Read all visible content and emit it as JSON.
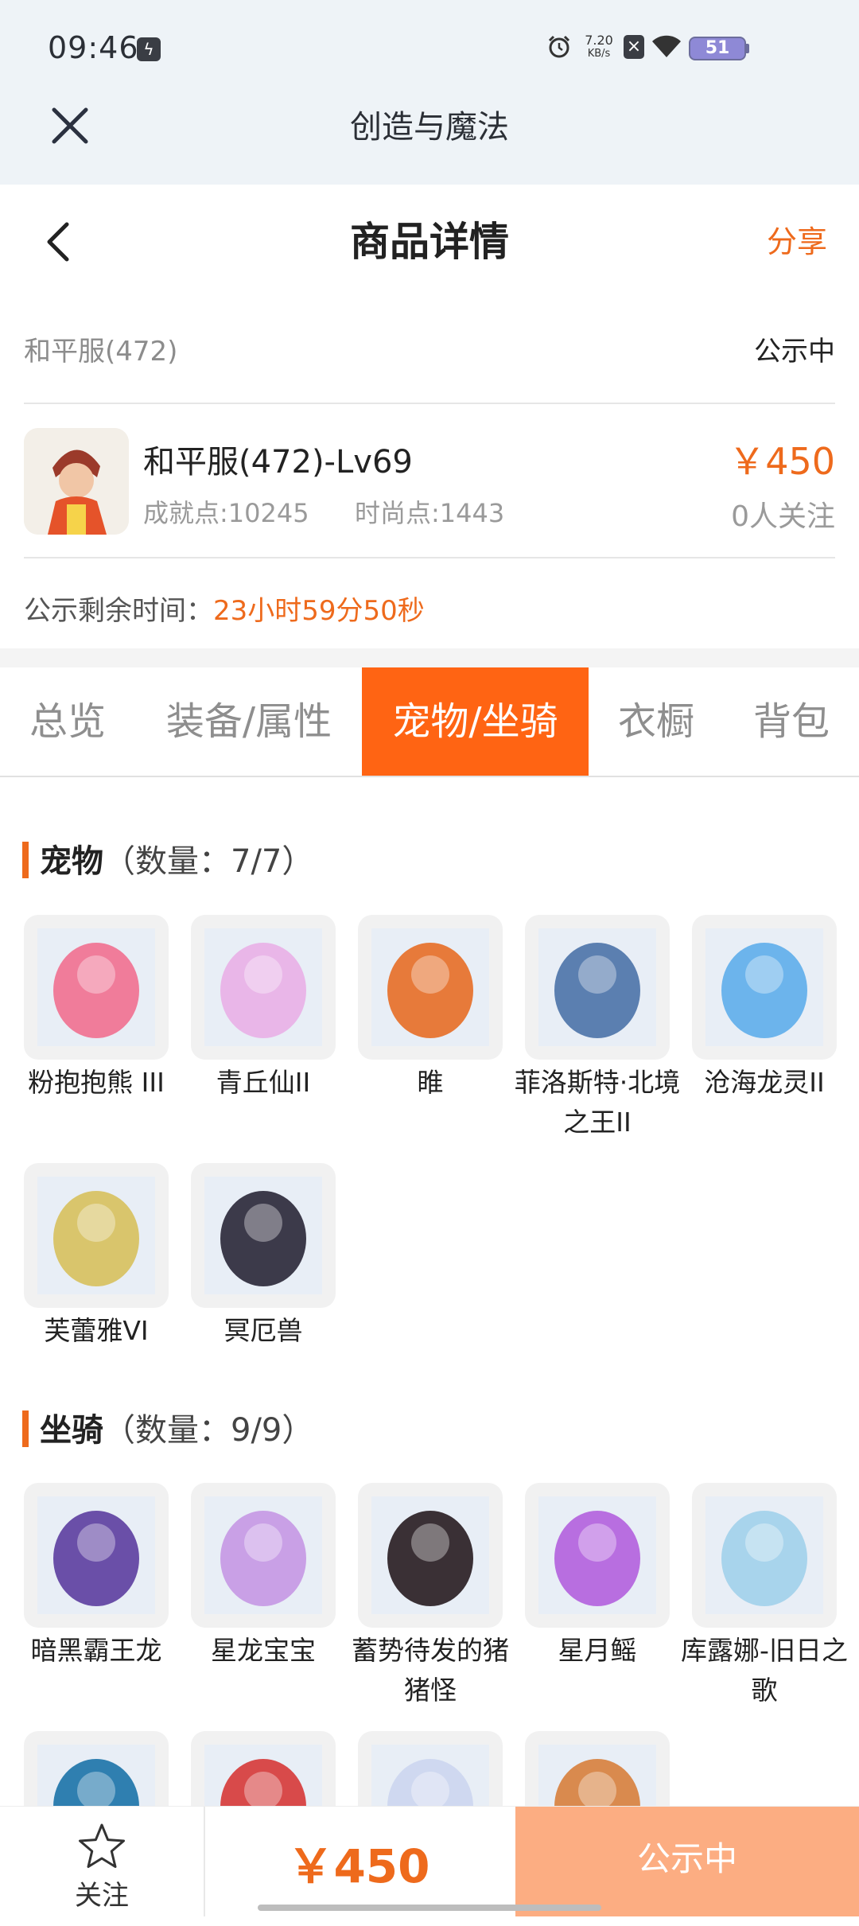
{
  "status_bar": {
    "time": "09:46",
    "net_speed_value": "7.20",
    "net_speed_unit": "KB/s",
    "battery": "51",
    "icons": [
      "flash-icon",
      "alarm-icon",
      "net-speed",
      "close-app-icon",
      "wifi-icon",
      "battery-icon"
    ]
  },
  "app_header": {
    "title": "创造与魔法"
  },
  "nav": {
    "title": "商品详情",
    "share": "分享"
  },
  "product": {
    "server": "和平服(472)",
    "status": "公示中",
    "name": "和平服(472)-Lv69",
    "achievement": "成就点:10245",
    "fashion": "时尚点:1443",
    "price": "￥450",
    "followers": "0人关注",
    "remaining_label": "公示剩余时间：",
    "remaining_value": "23小时59分50秒"
  },
  "tabs": [
    "总览",
    "装备/属性",
    "宠物/坐骑",
    "衣橱",
    "背包"
  ],
  "active_tab": "宠物/坐骑",
  "pets": {
    "title": "宠物",
    "count": "（数量：7/7）",
    "items": [
      {
        "label": "粉抱抱熊 III",
        "color": "#f07c9a"
      },
      {
        "label": "青丘仙II",
        "color": "#e9b6e8"
      },
      {
        "label": "睢",
        "color": "#e77a3a"
      },
      {
        "label": "菲洛斯特·北境之王II",
        "color": "#5b7fb0"
      },
      {
        "label": "沧海龙灵II",
        "color": "#6cb4ec"
      },
      {
        "label": "芙蕾雅VI",
        "color": "#d9c56c"
      },
      {
        "label": "冥厄兽",
        "color": "#3c3a4a"
      }
    ]
  },
  "mounts": {
    "title": "坐骑",
    "count": "（数量：9/9）",
    "items": [
      {
        "label": "暗黑霸王龙",
        "color": "#6a4fa8"
      },
      {
        "label": "星龙宝宝",
        "color": "#c9a0e6"
      },
      {
        "label": "蓄势待发的猪猪怪",
        "color": "#3a3035"
      },
      {
        "label": "星月鳐",
        "color": "#b86ee0"
      },
      {
        "label": "库露娜-旧日之歌",
        "color": "#a8d4ec"
      },
      {
        "label": "",
        "color": "#2f7fb0"
      },
      {
        "label": "",
        "color": "#d84a4a"
      },
      {
        "label": "",
        "color": "#cfd8f0"
      },
      {
        "label": "",
        "color": "#d98a4e"
      }
    ]
  },
  "bottom_bar": {
    "follow": "关注",
    "price": "￥450",
    "action": "公示中"
  },
  "colors": {
    "accent": "#ee6a1c",
    "tab_active": "#ff6413",
    "button_disabled": "#fcad82"
  }
}
